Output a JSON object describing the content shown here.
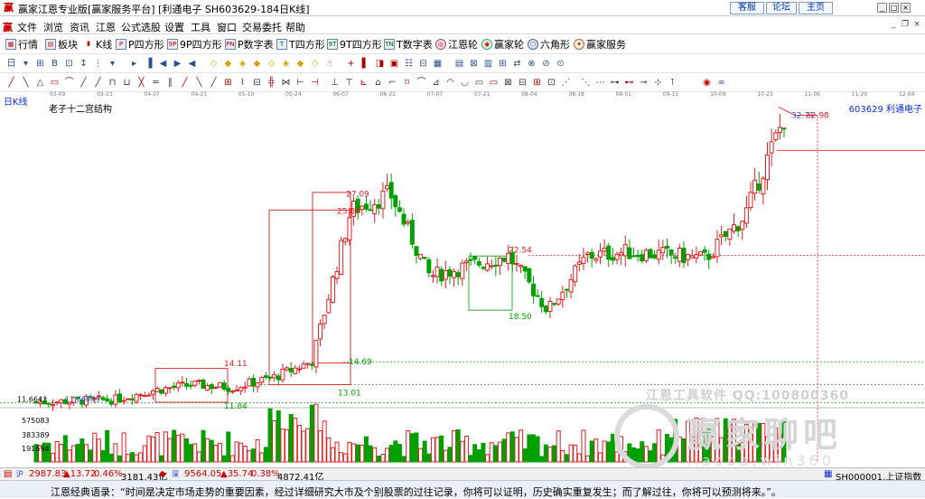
{
  "window": {
    "title": "赢家江恩专业版[赢家服务平台] [利通电子  SH603629-184日K线]",
    "links": [
      "客服",
      "论坛",
      "主页"
    ]
  },
  "menu": [
    "文件",
    "浏览",
    "资讯",
    "江恩",
    "公式选股",
    "设置",
    "工具",
    "窗口",
    "交易委托",
    "帮助"
  ],
  "toolbar1": [
    {
      "label": "行情",
      "icon": "grid-icon"
    },
    {
      "label": "板块",
      "icon": "blocks-icon"
    },
    {
      "label": "K线",
      "icon": "candlestick-icon"
    },
    {
      "label": "P四方形",
      "icon": "p-square-icon"
    },
    {
      "label": "9P四方形",
      "icon": "9p-square-icon"
    },
    {
      "label": "P数字表",
      "icon": "p-table-icon"
    },
    {
      "label": "T四方形",
      "icon": "t-square-icon"
    },
    {
      "label": "9T四方形",
      "icon": "9t-square-icon"
    },
    {
      "label": "T数字表",
      "icon": "t-table-icon"
    },
    {
      "label": "江恩轮",
      "icon": "gann-wheel-icon"
    },
    {
      "label": "赢家轮",
      "icon": "winner-wheel-icon"
    },
    {
      "label": "六角形",
      "icon": "hexagon-icon"
    },
    {
      "label": "赢家服务",
      "icon": "service-icon"
    }
  ],
  "chart": {
    "period_label": "日K线",
    "subtitle": "老子十二宫结构",
    "stock_label": "603629  利通电子",
    "dates": [
      "03-09",
      "03-23",
      "04-07",
      "04-21",
      "05-10",
      "05-24",
      "06-07",
      "06-21",
      "07-07",
      "07-21",
      "08-04",
      "08-18",
      "09-01",
      "09-15",
      "10-09",
      "10-23",
      "11-06",
      "11-20",
      "12-04"
    ],
    "price_labels": [
      "14.11",
      "11.84",
      "14.69",
      "13.01",
      "27.09",
      "25.88",
      "22.54",
      "18.50",
      "32.71",
      "32.98"
    ],
    "left_price": "11.6643",
    "small_label": "11.66643",
    "volume_axis": [
      "575083",
      "383389",
      "191694"
    ]
  },
  "chart_data": {
    "type": "candlestick",
    "x": [
      "03-09",
      "03-23",
      "04-07",
      "04-21",
      "05-10",
      "05-24",
      "06-07",
      "06-21",
      "07-07",
      "07-21",
      "08-04",
      "08-18",
      "09-01",
      "09-15",
      "10-09",
      "10-23",
      "11-06",
      "11-20",
      "12-04"
    ],
    "price_path": [
      11.7,
      11.8,
      11.9,
      12.6,
      13.0,
      12.8,
      13.5,
      14.7,
      25.9,
      27.1,
      21.0,
      21.8,
      22.5,
      18.5,
      22.5,
      22.8,
      22.6,
      22.3,
      25.5,
      32.7
    ],
    "labels": [
      "14.11",
      "11.84",
      "14.69",
      "13.01",
      "27.09",
      "25.88",
      "22.54",
      "18.50",
      "32.71",
      "32.98"
    ],
    "volume_ticks": [
      575083,
      383389,
      191694
    ]
  },
  "status": {
    "sh": "2987.83",
    "sh_chg": "▲13.72",
    "sh_pct": "0.46%",
    "sh_amt": "3181.43亿",
    "sz": "9564.05",
    "sz_chg": "▲35.74",
    "sz_pct": "0.38%",
    "sz_amt": "4872.41亿",
    "right": "SH000001,上证指数"
  },
  "quote": "江恩经典语录：“时间是决定市场走势的重要因素，经过详细研究大市及个别股票的过往记录，你将可以证明，历史确实重复发生；而了解过往，你将可以预测将来。”。",
  "watermark": {
    "line1": "江恩工具软件 QQ:100800360",
    "line2": "赢家聊吧",
    "line3": "liaoba.win360"
  },
  "colors": {
    "up": "#e02020",
    "down": "#00a000",
    "accent": "#0a2ad8"
  }
}
